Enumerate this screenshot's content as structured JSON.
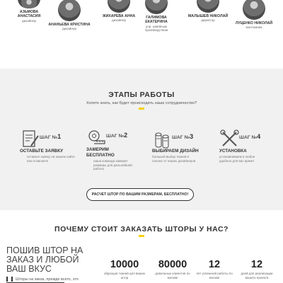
{
  "team": [
    {
      "name": "АЗЬМОВА АНАСТАСИЯ",
      "role": "дизайнер"
    },
    {
      "name": "АНАНЬЕВА КРИСТИНА",
      "role": "дизайнер"
    },
    {
      "name": "ЖИХАРЕВА АННА",
      "role": "дизайнер"
    },
    {
      "name": "ГАЛИМОВА ЕКАТЕРИНА",
      "role": "упр. швейным производством"
    },
    {
      "name": "МАЛЫШЕВ НИКОЛАЙ",
      "role": "директор"
    },
    {
      "name": "ЛУЦЕНКО НИКОЛАЙ",
      "role": "монтажник"
    }
  ],
  "stages": {
    "title": "ЭТАПЫ РАБОТЫ",
    "subtitle": "Хотите знать, как будет происходить наше сотрудничество?",
    "steps": [
      {
        "num_prefix": "ШАГ №",
        "num": "1",
        "title": "ОСТАВЬТЕ ЗАЯВКУ",
        "desc": "оставьте заявку на нашем сайте или позвоните",
        "icon": "form-icon"
      },
      {
        "num_prefix": "ШАГ №",
        "num": "2",
        "title": "ЗАМЕРИМ БЕСПЛАТНО",
        "desc": "наша команда замерит размеры для дальнейшей работы",
        "icon": "measure-icon"
      },
      {
        "num_prefix": "ШАГ №",
        "num": "3",
        "title": "ВЫБИРАЕМ ДИЗАЙН",
        "desc": "большой выбор тканей в салоне от наших дизайнеров",
        "icon": "fabric-icon"
      },
      {
        "num_prefix": "ШАГ №",
        "num": "4",
        "title": "УСТАНОВКА",
        "desc": "устанавливаем в любое удобное для вас время",
        "icon": "tools-icon"
      }
    ],
    "cta_label": "РАСЧЕТ ШТОР ПО ВАШИМ РАЗМЕРАМ, БЕСПЛАТНО!"
  },
  "why": {
    "title": "ПОЧЕМУ СТОИТ ЗАКАЗАТЬ ШТОРЫ У НАС?",
    "lead": "ПОШИВ ШТОР НА ЗАКАЗ И ЛЮБОЙ ВАШ ВКУС",
    "paragraph": "Шторы на заказ, прежде всего, это",
    "stats": [
      {
        "num": "10000",
        "label": "образцов тканей для ваших штор"
      },
      {
        "num": "80000",
        "label": "довольных клиентов по москве"
      },
      {
        "num": "12",
        "label": "лет успешной работы по москве"
      },
      {
        "num": "12",
        "label": "дней для реализации вашего проекта"
      }
    ]
  },
  "colors": {
    "accent": "#f5d000",
    "section_bg": "#f1f1f1"
  }
}
